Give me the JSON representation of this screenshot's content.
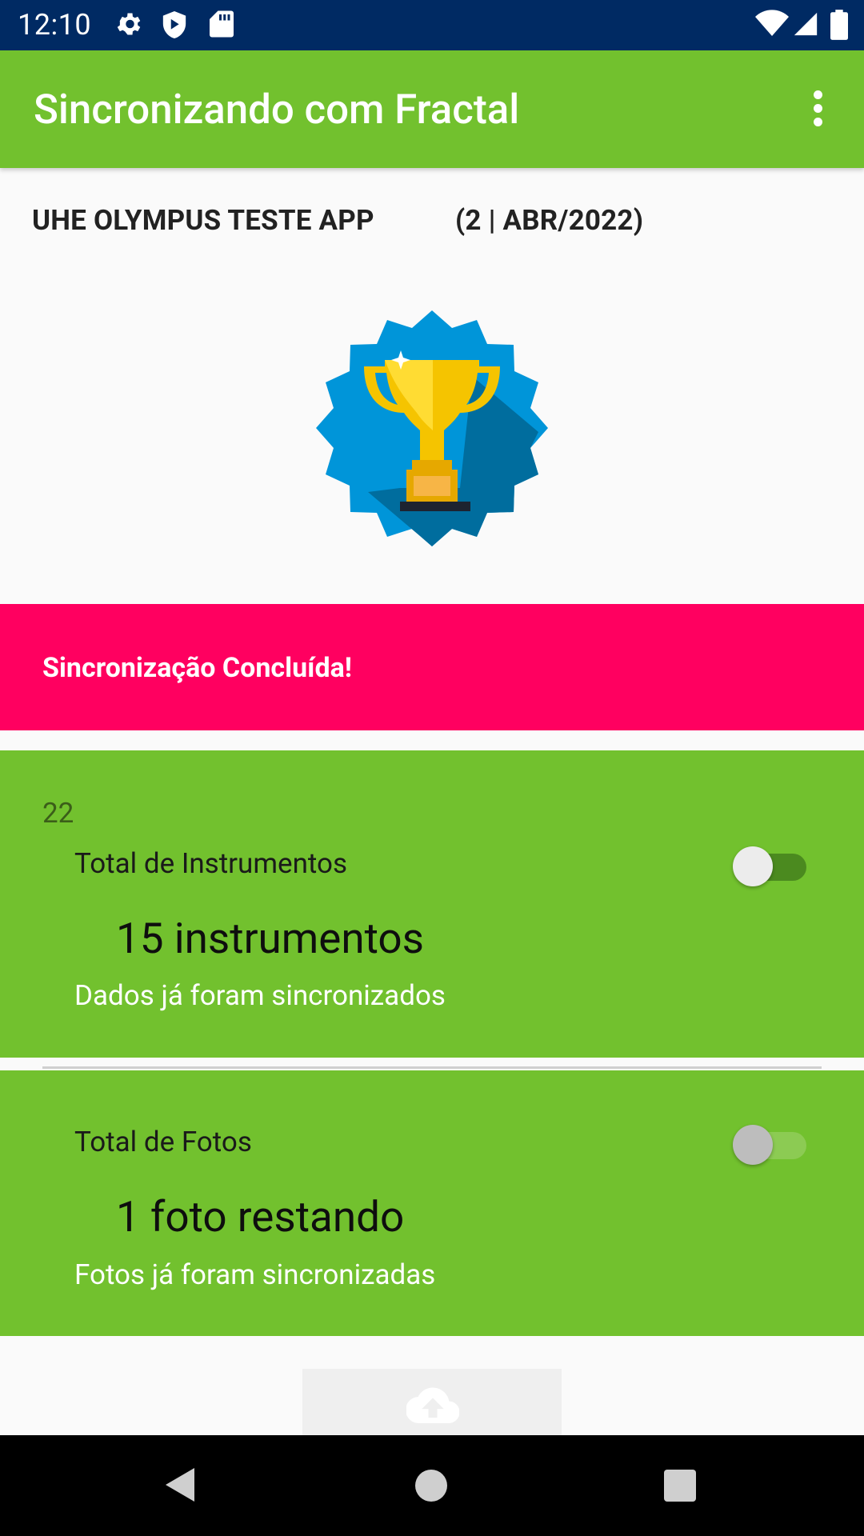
{
  "status_bar": {
    "time": "12:10",
    "left_icons": [
      "gear-icon",
      "shield-icon",
      "sd-card-icon"
    ],
    "right_icons": [
      "wifi-icon",
      "signal-icon",
      "battery-icon"
    ]
  },
  "toolbar": {
    "title": "Sincronizando com Fractal",
    "menu_icon": "more-vert-icon"
  },
  "project": {
    "name": "UHE OLYMPUS TESTE APP",
    "period": "(2 | ABR/2022)"
  },
  "banner": {
    "text": "Sincronização Concluída!",
    "color": "#ff0060"
  },
  "instruments_card": {
    "count": "22",
    "label": "Total de Instrumentos",
    "value": "15 instrumentos",
    "status": "Dados já foram sincronizados",
    "toggle_on": true
  },
  "photos_card": {
    "label": "Total de Fotos",
    "value": "1 foto restando",
    "status": "Fotos já foram sincronizadas",
    "toggle_on": false
  },
  "upload_button": {
    "icon": "cloud-upload-icon"
  },
  "nav_bar": {
    "buttons": [
      "back-icon",
      "home-icon",
      "recents-icon"
    ]
  },
  "colors": {
    "status_bar": "#002a63",
    "primary": "#72c12e",
    "accent": "#ff0060"
  }
}
